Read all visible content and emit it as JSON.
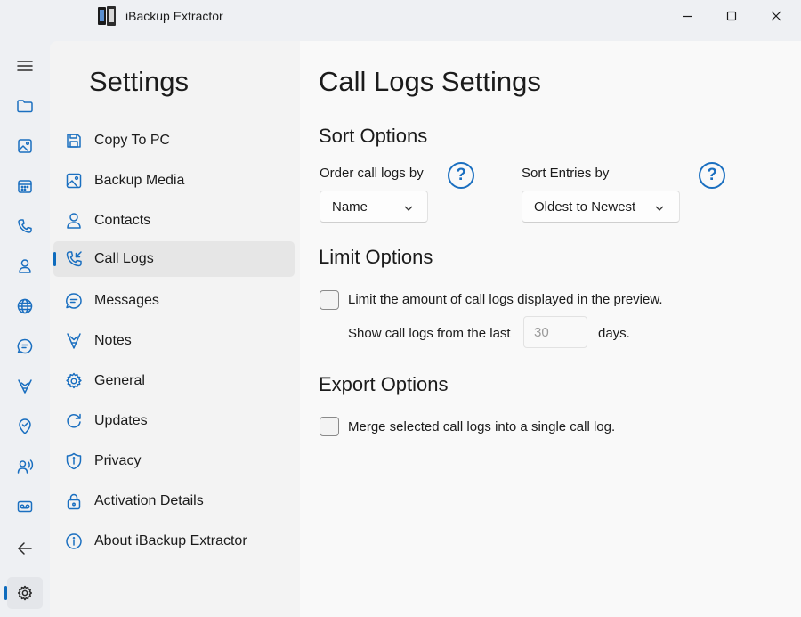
{
  "window": {
    "title": "iBackup Extractor",
    "controls": [
      "minimize-icon",
      "maximize-icon",
      "close-icon"
    ]
  },
  "rail": {
    "items": [
      {
        "icon": "hamburger-menu-icon"
      },
      {
        "icon": "folder-icon"
      },
      {
        "icon": "image-icon"
      },
      {
        "icon": "calendar-icon"
      },
      {
        "icon": "phone-icon"
      },
      {
        "icon": "person-icon"
      },
      {
        "icon": "globe-icon"
      },
      {
        "icon": "chat-icon"
      },
      {
        "icon": "notes-icon"
      },
      {
        "icon": "location-check-icon"
      },
      {
        "icon": "person-voice-icon"
      },
      {
        "icon": "voicemail-icon"
      },
      {
        "icon": "back-arrow-icon"
      },
      {
        "icon": "settings-gear-icon",
        "active": true
      }
    ]
  },
  "settings_nav": {
    "title": "Settings",
    "items": [
      {
        "label": "Copy To PC",
        "icon": "save-icon"
      },
      {
        "label": "Backup Media",
        "icon": "image-icon"
      },
      {
        "label": "Contacts",
        "icon": "person-icon"
      },
      {
        "label": "Call Logs",
        "icon": "call-incoming-icon",
        "active": true
      },
      {
        "label": "Messages",
        "icon": "chat-icon"
      },
      {
        "label": "Notes",
        "icon": "notes-icon"
      },
      {
        "label": "General",
        "icon": "gear-icon"
      },
      {
        "label": "Updates",
        "icon": "refresh-icon"
      },
      {
        "label": "Privacy",
        "icon": "shield-info-icon"
      },
      {
        "label": "Activation Details",
        "icon": "lock-icon"
      },
      {
        "label": "About iBackup Extractor",
        "icon": "info-icon"
      }
    ]
  },
  "content": {
    "title": "Call Logs Settings",
    "sort": {
      "title": "Sort Options",
      "order_label": "Order call logs by",
      "order_value": "Name",
      "entries_label": "Sort Entries by",
      "entries_value": "Oldest to Newest",
      "help_glyph": "?"
    },
    "limit": {
      "title": "Limit Options",
      "checkbox_label": "Limit the amount of call logs displayed in the preview.",
      "checked": false,
      "show_prefix": "Show call logs from the last",
      "days_value": "30",
      "show_suffix": "days."
    },
    "export": {
      "title": "Export Options",
      "checkbox_label": "Merge selected call logs into a single call log.",
      "checked": false
    }
  },
  "colors": {
    "accent": "#1a6fc0",
    "indicator": "#0f6cbd",
    "window_bg": "#eef0f3",
    "nav_bg": "#f3f3f3",
    "content_bg": "#f9f9f9"
  }
}
